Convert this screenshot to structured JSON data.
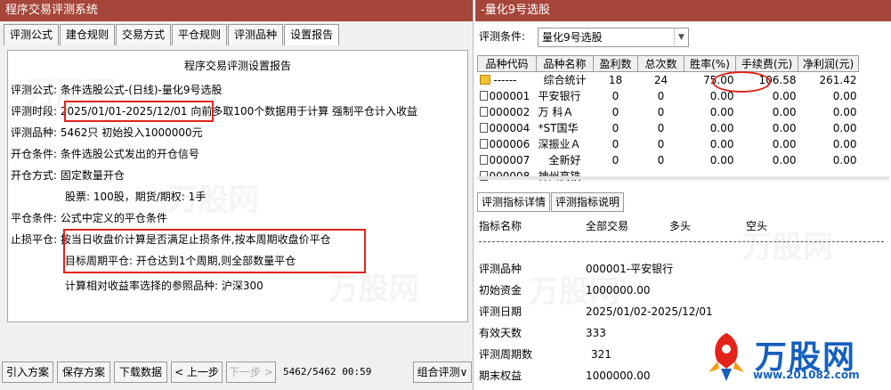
{
  "left": {
    "title": "程序交易评测系统",
    "tabs": [
      "评测公式",
      "建仓规则",
      "交易方式",
      "平仓规则",
      "评测品种",
      "设置报告"
    ],
    "active_tab": "设置报告",
    "report": {
      "title": "程序交易评测设置报告",
      "lines": [
        "评测公式: 条件选股公式-(日线)-量化9号选股",
        "评测时段: 2025/01/01-2025/12/01 向前多取100个数据用于计算 强制平仓计入收益",
        "评测品种: 5462只 初始投入1000000元",
        "开仓条件: 条件选股公式发出的开仓信号",
        "开仓方式: 固定数量开仓",
        "股票: 100股，期货/期权: 1手",
        "平仓条件: 公式中定义的平仓条件",
        "止损平仓: 按当日收盘价计算是否满足止损条件,按本周期收盘价平仓",
        "目标周期平仓: 开仓达到1个周期,则全部数量平仓",
        "计算相对收益率选择的参照品种: 沪深300"
      ]
    },
    "buttons": {
      "import": "引入方案",
      "save": "保存方案",
      "download": "下载数据",
      "prev": "< 上一步",
      "next": "下一步 >",
      "combo": "组合评测∨"
    },
    "status": "5462/5462 00:59"
  },
  "right": {
    "title": "-量化9号选股",
    "condition_label": "评测条件:",
    "condition_value": "量化9号选股",
    "table": {
      "headers": [
        "品种代码",
        "品种名称",
        "盈利数",
        "总次数",
        "胜率(%)",
        "手续费(元)",
        "净利润(元)"
      ],
      "summary": {
        "code": "------",
        "name": "综合统计",
        "wins": "18",
        "total": "24",
        "rate": "75.00",
        "fee": "106.58",
        "profit": "261.42"
      },
      "rows": [
        {
          "code": "000001",
          "name": "平安银行",
          "wins": "0",
          "total": "0",
          "rate": "0.00",
          "fee": "0.00",
          "profit": "0.00"
        },
        {
          "code": "000002",
          "name": "万 科Ａ",
          "wins": "0",
          "total": "0",
          "rate": "0.00",
          "fee": "0.00",
          "profit": "0.00"
        },
        {
          "code": "000004",
          "name": "*ST国华",
          "wins": "0",
          "total": "0",
          "rate": "0.00",
          "fee": "0.00",
          "profit": "0.00"
        },
        {
          "code": "000006",
          "name": "深振业Ａ",
          "wins": "0",
          "total": "0",
          "rate": "0.00",
          "fee": "0.00",
          "profit": "0.00"
        },
        {
          "code": "000007",
          "name": "全新好",
          "wins": "0",
          "total": "0",
          "rate": "0.00",
          "fee": "0.00",
          "profit": "0.00"
        }
      ],
      "partial_row": {
        "code": "000008",
        "name": "神州高铁"
      }
    },
    "detail_tabs": [
      "评测指标详情",
      "评测指标说明"
    ],
    "detail_header": [
      "指标名称",
      "全部交易",
      "多头",
      "空头"
    ],
    "details": [
      {
        "label": "评测品种",
        "value": "000001-平安银行"
      },
      {
        "label": "初始资金",
        "value": "1000000.00"
      },
      {
        "label": "评测日期",
        "value": "2025/01/02-2025/12/01"
      },
      {
        "label": "有效天数",
        "value": "333"
      },
      {
        "label": "评测周期数",
        "value": "321"
      },
      {
        "label": "期末权益",
        "value": "1000000.00"
      }
    ]
  },
  "logo": {
    "text": "万股网",
    "url": "www.201082.com"
  },
  "colors": {
    "titlebar": "#a6463a",
    "highlight": "#e2231a",
    "logo": "#1560bd"
  }
}
